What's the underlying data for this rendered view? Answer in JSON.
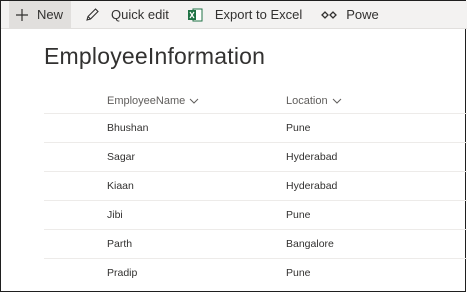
{
  "commandbar": {
    "new_label": "New",
    "quick_edit_label": "Quick edit",
    "export_label": "Export to Excel",
    "power_label": "Powe",
    "icons": [
      "plus-icon",
      "pencil-icon",
      "excel-icon",
      "power-apps-icon"
    ]
  },
  "list": {
    "title": "EmployeeInformation",
    "columns": [
      "EmployeeName",
      "Location"
    ],
    "rows": [
      {
        "name": "Bhushan",
        "location": "Pune"
      },
      {
        "name": "Sagar",
        "location": "Hyderabad"
      },
      {
        "name": "Kiaan",
        "location": "Hyderabad"
      },
      {
        "name": "Jibi",
        "location": "Pune"
      },
      {
        "name": "Parth",
        "location": "Bangalore"
      },
      {
        "name": "Pradip",
        "location": "Pune"
      }
    ]
  },
  "colors": {
    "commandbar_bg": "#f3f2f1",
    "excel_green": "#217346",
    "text": "#323130",
    "header_text": "#605e5c"
  }
}
